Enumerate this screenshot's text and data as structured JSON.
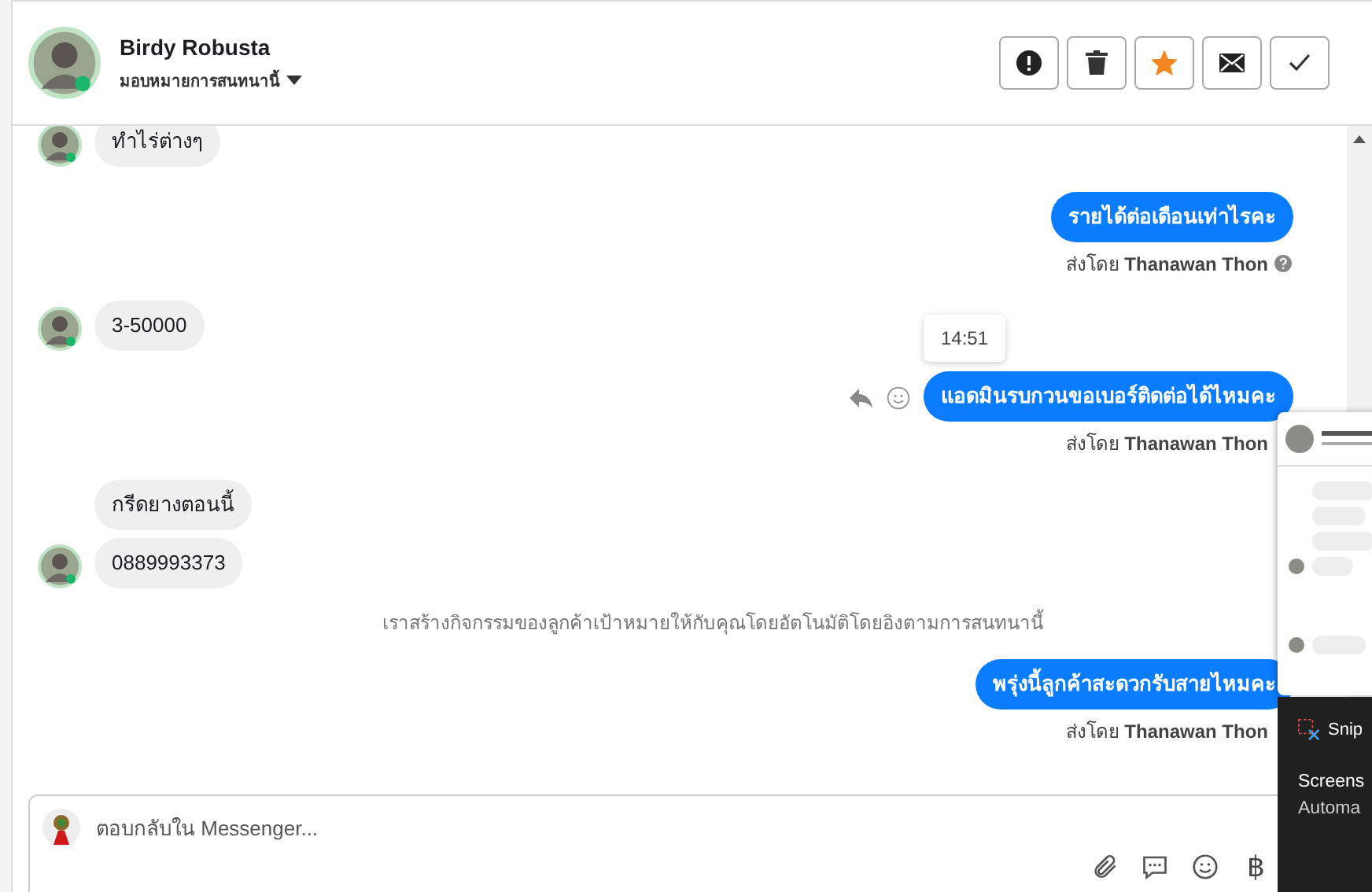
{
  "header": {
    "name": "Birdy Robusta",
    "assign": "มอบหมายการสนทนานี้",
    "actions": [
      {
        "kind": "alert"
      },
      {
        "kind": "trash"
      },
      {
        "kind": "star",
        "on": true
      },
      {
        "kind": "mail"
      },
      {
        "kind": "check"
      }
    ]
  },
  "messages": [
    {
      "kind": "incoming",
      "text": "ทำไร่ต่างๆ",
      "avatar": true
    },
    {
      "kind": "outgoing",
      "text": "รายได้ต่อเดือนเท่าไรคะ",
      "sent_by": "ส่งโดย",
      "sender": "Thanawan Thon",
      "help": true,
      "hover": false
    },
    {
      "kind": "incoming",
      "text": "3-50000",
      "avatar": true
    },
    {
      "kind": "outgoing",
      "time": "14:51",
      "text": "แอดมินรบกวนขอเบอร์ติดต่อได้ไหมคะ",
      "sent_by": "ส่งโดย",
      "sender": "Thanawan Thon",
      "hover": true
    },
    {
      "kind": "incoming",
      "text": "กรีดยางตอนนี้",
      "avatar": false
    },
    {
      "kind": "incoming",
      "text": "0889993373",
      "avatar": true
    },
    {
      "kind": "system",
      "text": "เราสร้างกิจกรรมของลูกค้าเป้าหมายให้กับคุณโดยอัตโนมัติโดยอิงตามการสนทนานี้"
    },
    {
      "kind": "outgoing",
      "text": "พรุ่งนี้ลูกค้าสะดวกรับสายไหมคะ",
      "sent_by": "ส่งโดย",
      "sender": "Thanawan Thon",
      "hover": false
    }
  ],
  "composer": {
    "placeholder": "ตอบกลับใน Messenger...",
    "tools": [
      {
        "kind": "attach"
      },
      {
        "kind": "chat"
      },
      {
        "kind": "emoji"
      },
      {
        "kind": "baht",
        "text": "฿"
      }
    ]
  },
  "notification": {
    "app": "Snip",
    "lines": [
      "Screens",
      "Automa"
    ]
  }
}
